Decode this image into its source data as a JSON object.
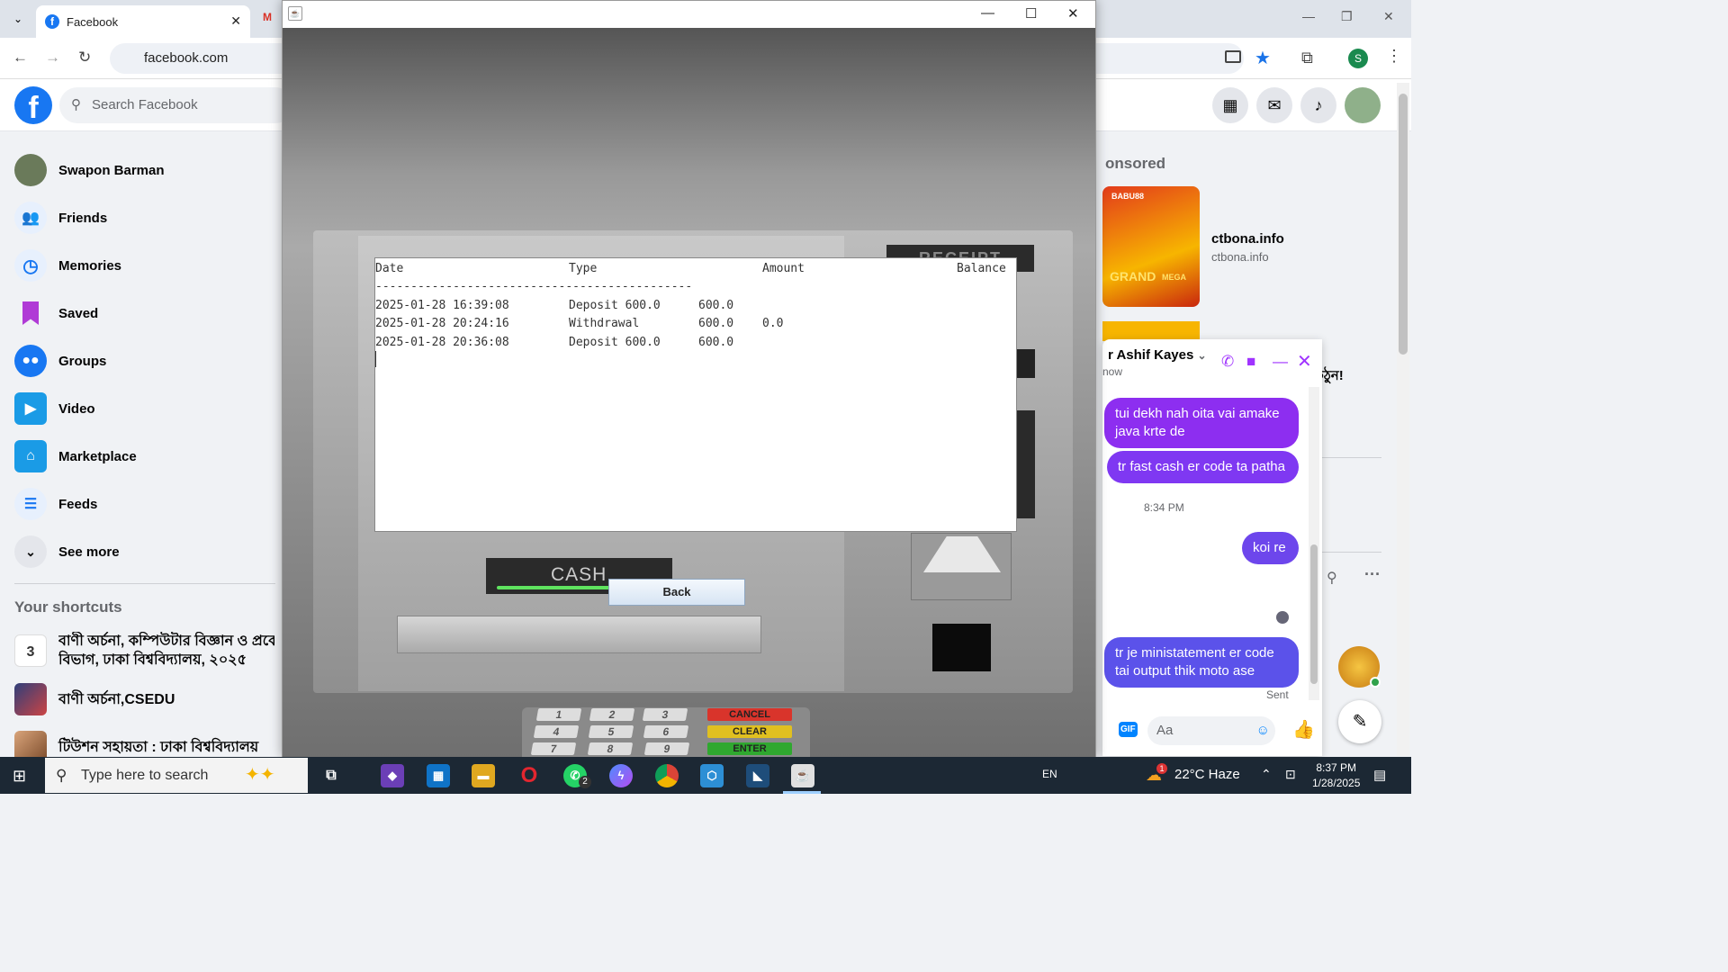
{
  "browser": {
    "tab_title": "Facebook",
    "tab_close": "✕",
    "tab_menu": "⌄",
    "gmail_tab_icon": "M",
    "url": "facebook.com",
    "profile_letter": "S",
    "controls": {
      "min": "—",
      "max": "❐",
      "close": "✕"
    },
    "nav": {
      "back": "←",
      "forward": "→",
      "reload": "↻"
    },
    "toolbar_icons": [
      "install-icon",
      "star-icon",
      "extensions-icon",
      "menu-icon"
    ]
  },
  "facebook": {
    "logo": "f",
    "search_placeholder": "Search Facebook",
    "header_icons": [
      "menu-grid-icon",
      "messenger-icon",
      "notifications-icon",
      "account-icon"
    ],
    "left_nav": [
      {
        "label": "Swapon Barman",
        "icon": "avatar"
      },
      {
        "label": "Friends",
        "icon": "friends-icon"
      },
      {
        "label": "Memories",
        "icon": "memories-icon"
      },
      {
        "label": "Saved",
        "icon": "saved-icon"
      },
      {
        "label": "Groups",
        "icon": "groups-icon"
      },
      {
        "label": "Video",
        "icon": "video-icon"
      },
      {
        "label": "Marketplace",
        "icon": "marketplace-icon"
      },
      {
        "label": "Feeds",
        "icon": "feeds-icon"
      },
      {
        "label": "See more",
        "icon": "chevron-down-icon"
      }
    ],
    "shortcuts_title": "Your shortcuts",
    "shortcuts": [
      {
        "line1": "বাণী অর্চনা, কম্পিউটার বিজ্ঞান ও প্রকে",
        "line2": "বিভাগ, ঢাকা বিশ্ববিদ্যালয়, ২০২৫"
      },
      {
        "line1": "বাণী অর্চনা,CSEDU",
        "line2": ""
      },
      {
        "line1": "টিউশন সহায়তা : ঢাকা বিশ্ববিদ্যালয়",
        "line2": ""
      }
    ],
    "sponsored": "onsored",
    "ad": {
      "title": "ctbona.info",
      "url": "ctbona.info",
      "creative_top": "BABU88",
      "creative_grand": "GRAND",
      "creative_mega": "MEGA"
    },
    "bangla_snippet": "য়ে উঠুন!",
    "chat": {
      "name": "r Ashif Kayes",
      "status": "now",
      "messages": [
        "tui dekh nah oita vai amake java krte de",
        "tr fast cash er code ta patha",
        "koi re",
        "tr je ministatement er code tai output thik moto ase"
      ],
      "time_divider": "8:34 PM",
      "sent": "Sent",
      "input_placeholder": "Aa",
      "gif": "GIF",
      "like": "👍"
    }
  },
  "atm": {
    "receipt_label": "RECEIPT",
    "cash_label": "CASH",
    "back_button": "Back",
    "keypad": [
      "1",
      "2",
      "3",
      "4",
      "5",
      "6",
      "7",
      "8",
      "9"
    ],
    "function_keys": {
      "cancel": "CANCEL",
      "clear": "CLEAR",
      "enter": "ENTER"
    },
    "statement": {
      "headers": [
        "Date",
        "Type",
        "Amount",
        "Balance"
      ],
      "divider": "---------------------------------------------",
      "rows": [
        {
          "date": "2025-01-28 16:39:08",
          "type": "Deposit 600.0",
          "amount": "600.0",
          "balance": ""
        },
        {
          "date": "2025-01-28 20:24:16",
          "type": "Withdrawal",
          "amount": "600.0",
          "balance": "0.0"
        },
        {
          "date": "2025-01-28 20:36:08",
          "type": "Deposit 600.0",
          "amount": "600.0",
          "balance": ""
        }
      ]
    }
  },
  "taskbar": {
    "search_placeholder": "Type here to search",
    "language": "EN",
    "weather": "22°C  Haze",
    "time": "8:37 PM",
    "date": "1/28/2025",
    "whatsapp_badge": "2",
    "weather_badge": "1"
  }
}
